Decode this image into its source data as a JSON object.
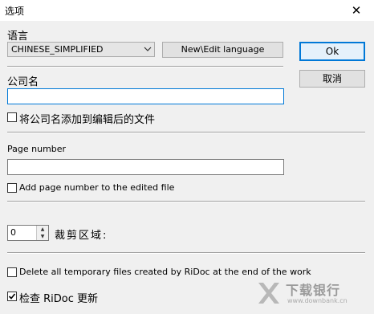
{
  "window": {
    "title": "选项",
    "close_glyph": "✕"
  },
  "language": {
    "label": "语言",
    "selected": "CHINESE_SIMPLIFIED",
    "edit_button": "New\\Edit language"
  },
  "buttons": {
    "ok": "Ok",
    "cancel": "取消"
  },
  "company": {
    "label": "公司名",
    "value": "",
    "checkbox_label": "将公司名添加到编辑后的文件",
    "checked": false
  },
  "page_number": {
    "label": "Page number",
    "value": "",
    "checkbox_label": "Add page number to the edited file",
    "checked": false
  },
  "crop": {
    "value": "0",
    "label": "裁剪区域:"
  },
  "options": {
    "delete_temp_label": "Delete all temporary files created by RiDoc at the end of the work",
    "delete_temp_checked": false,
    "check_updates_label": "检查 RiDoc 更新",
    "check_updates_checked": true
  },
  "watermark": {
    "brand": "下载银行",
    "url": "www.downbank.cn"
  }
}
